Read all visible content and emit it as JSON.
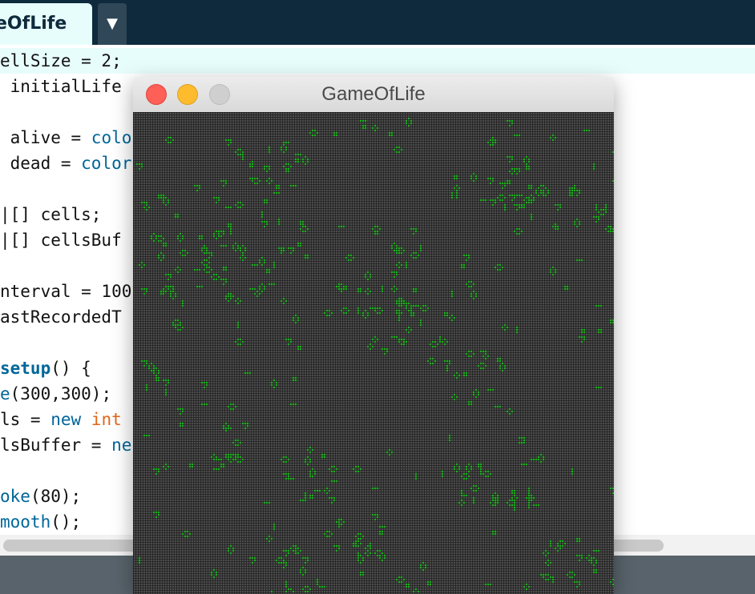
{
  "ide": {
    "tab_label": "eOfLife",
    "tab_menu_glyph": "▼",
    "code_lines": [
      [
        "",
        "ellSize = 2;",
        ""
      ],
      [
        "",
        " initialLife",
        ""
      ],
      [
        "",
        "",
        ""
      ],
      [
        "",
        " alive = ",
        "colo"
      ],
      [
        "",
        " dead = ",
        "color"
      ],
      [
        "",
        "",
        ""
      ],
      [
        "",
        "|[] cells;",
        ""
      ],
      [
        "",
        "|[] cellsBuf",
        ""
      ],
      [
        "",
        "",
        ""
      ],
      [
        "",
        "nterval = 100",
        ""
      ],
      [
        "",
        "astRecordedT",
        ""
      ],
      [
        "",
        "",
        ""
      ],
      [
        "setup",
        "() {",
        ""
      ],
      [
        "e",
        "(300,300);",
        ""
      ],
      [
        "",
        "ls = ",
        "new int"
      ],
      [
        "",
        "lsBuffer = ",
        "ne"
      ],
      [
        "",
        "",
        ""
      ],
      [
        "oke",
        "(80);",
        ""
      ],
      [
        "mooth",
        "();",
        ""
      ]
    ]
  },
  "sketch_window": {
    "title": "GameOfLife",
    "buttons": {
      "close": "close",
      "minimize": "minimize",
      "zoom": "zoom"
    }
  },
  "colors": {
    "tabbar": "#0e2a3c",
    "editor_highlight": "#e7fdfc",
    "keyword": "#006699",
    "type": "#e2661a",
    "canvas_bg": "#5a5a5a",
    "grid_line": "#1e1e1e",
    "cell_alive": "#22dd22"
  },
  "icons": {
    "tab_menu": "chevron-down-icon"
  }
}
